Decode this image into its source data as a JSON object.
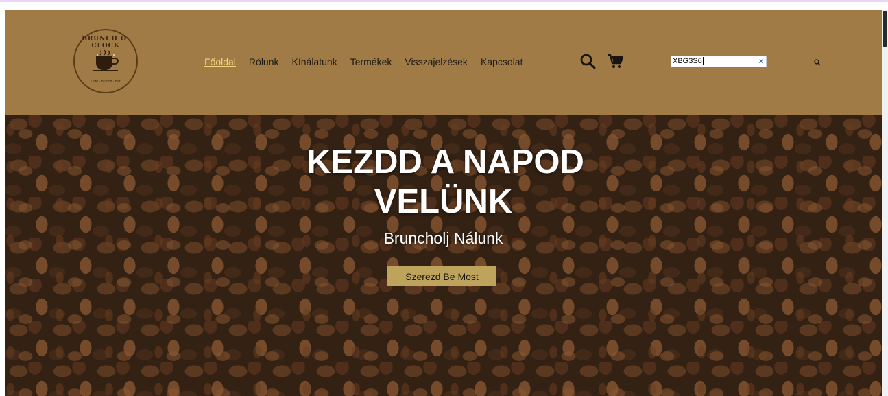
{
  "header": {
    "logo": {
      "arc_text": "BRUNCH O' CLOCK",
      "sub_text": "Café · Brunch · Bar"
    },
    "nav": [
      {
        "label": "Főoldal",
        "active": true
      },
      {
        "label": "Rólunk",
        "active": false
      },
      {
        "label": "Kínálatunk",
        "active": false
      },
      {
        "label": "Termékek",
        "active": false
      },
      {
        "label": "Visszajelzések",
        "active": false
      },
      {
        "label": "Kapcsolat",
        "active": false
      }
    ],
    "search": {
      "value": "XBG3S6",
      "clear_label": "×"
    },
    "icons": [
      "search-icon",
      "cart-icon",
      "search-submit-icon"
    ]
  },
  "hero": {
    "title_line1": "KEZDD A NAPOD",
    "title_line2": "VELÜNK",
    "subtitle": "Bruncholj Nálunk",
    "button_label": "Szerezd Be Most"
  },
  "colors": {
    "header_bg": "#a17b46",
    "nav_active": "#f3d57a",
    "hero_button": "#bea35c"
  }
}
